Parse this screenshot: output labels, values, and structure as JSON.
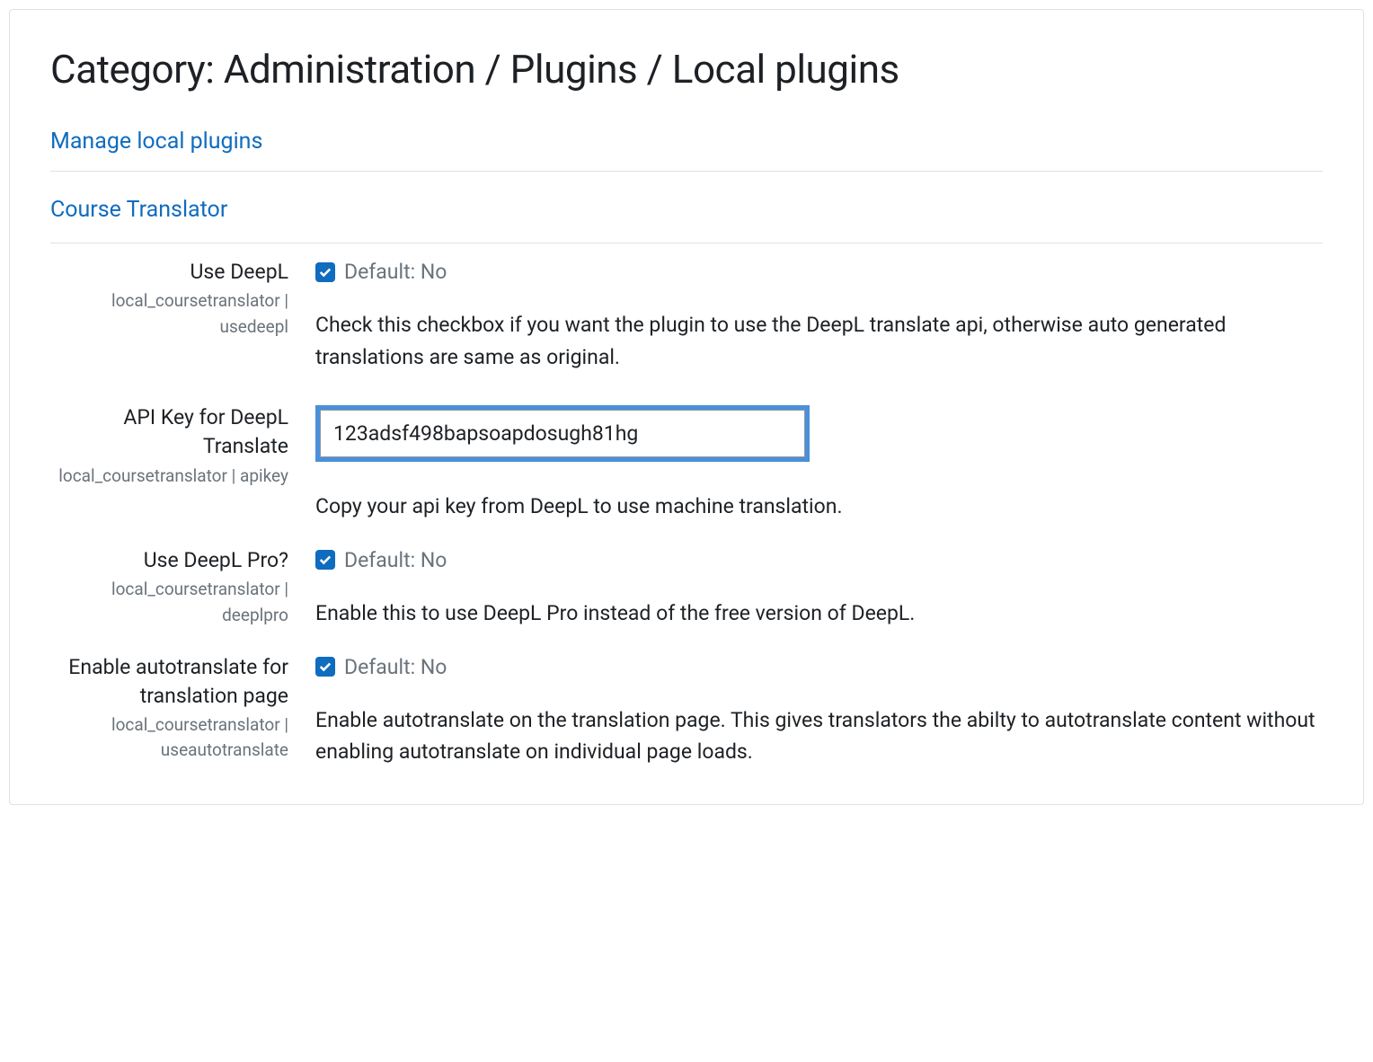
{
  "page": {
    "title": "Category: Administration / Plugins / Local plugins"
  },
  "sections": {
    "manage_link": "Manage local plugins",
    "plugin_link": "Course Translator"
  },
  "settings": [
    {
      "label": "Use DeepL",
      "id": "local_coursetranslator | usedeepl",
      "type": "checkbox",
      "checked": true,
      "default": "Default: No",
      "desc": "Check this checkbox if you want the plugin to use the DeepL translate api, otherwise auto generated translations are same as original."
    },
    {
      "label": "API Key for DeepL Translate",
      "id": "local_coursetranslator | apikey",
      "type": "text",
      "value": "123adsf498bapsoapdosugh81hg",
      "desc": "Copy your api key from DeepL to use machine translation."
    },
    {
      "label": "Use DeepL Pro?",
      "id": "local_coursetranslator | deeplpro",
      "type": "checkbox",
      "checked": true,
      "default": "Default: No",
      "desc": "Enable this to use DeepL Pro instead of the free version of DeepL."
    },
    {
      "label": "Enable autotranslate for translation page",
      "id": "local_coursetranslator | useautotranslate",
      "type": "checkbox",
      "checked": true,
      "default": "Default: No",
      "desc": "Enable autotranslate on the translation page. This gives translators the abilty to autotranslate content without enabling autotranslate on individual page loads."
    }
  ]
}
